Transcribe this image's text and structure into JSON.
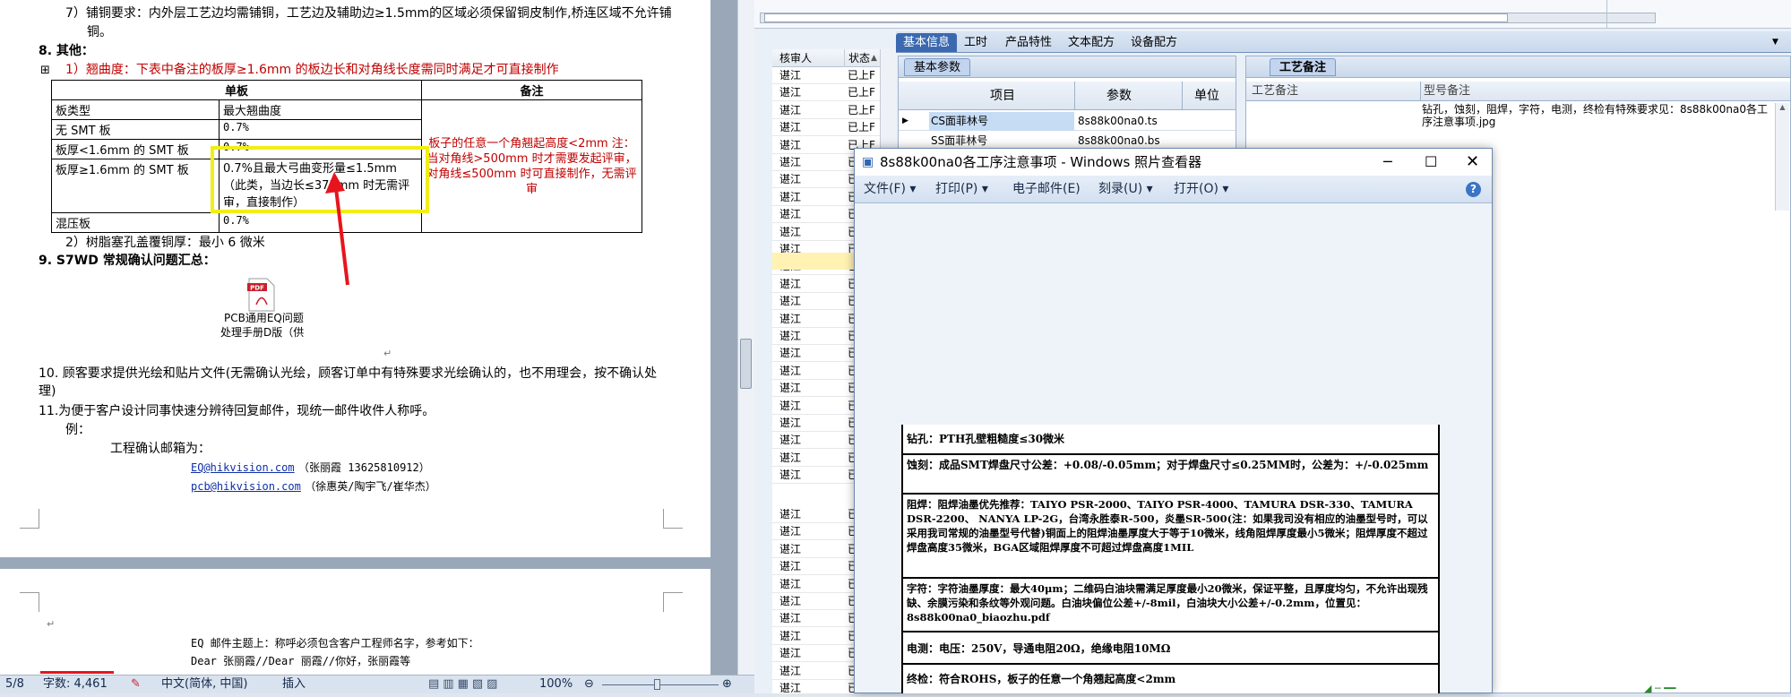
{
  "word_doc": {
    "line_7": "7）铺铜要求：内外层工艺边均需铺铜，工艺边及辅助边≥1.5mm的区域必须保留铜皮制作,桥连区域不允许铺",
    "line_7_cont": "铜。",
    "sec8_title": "8.   其他：",
    "sec8_1": "1）翘曲度：下表中备注的板厚≥1.6mm 的板边长和对角线长度需同时满足才可直接制作",
    "table": {
      "header_left": "单板",
      "header_right": "备注",
      "col1": "板类型",
      "col2": "最大翘曲度",
      "rows": [
        {
          "type": "无 SMT 板",
          "value": "0.7%"
        },
        {
          "type": "板厚<1.6mm 的 SMT 板",
          "value": "0.7%"
        },
        {
          "type": "板厚≥1.6mm 的 SMT 板",
          "value": "0.7%且最大弓曲变形量≤1.5mm（此类，当边长≤375mm 时无需评审，直接制作）"
        },
        {
          "type": "混压板",
          "value": "0.7%"
        }
      ],
      "note": "板子的任意一个角翘起高度<2mm 注：当对角线>500mm 时才需要发起评审，对角线≤500mm 时可直接制作，无需评审"
    },
    "sec8_2": "2）树脂塞孔盖覆铜厚：最小 6 微米",
    "sec9": "9.   S7WD 常规确认问题汇总：",
    "pdf_caption_1": "PCB通用EQ问题",
    "pdf_caption_2": "处理手册D版（供",
    "sec10": "10.  顾客要求提供光绘和贴片文件(无需确认光绘，顾客订单中有特殊要求光绘确认的，也不用理会，按不确认处",
    "sec10_cont": "理)",
    "sec11": "11.为便于客户设计同事快速分辨待回复邮件，现统一邮件收件人称呼。",
    "example": "例：",
    "mail_label": "工程确认邮箱为：",
    "mail_1": "EQ@hikvision.com",
    "mail_1_note": "（张丽霞 13625810912）",
    "mail_2": "pcb@hikvision.com",
    "mail_2_note": "（徐惠英/陶宇飞/崔华杰）",
    "page2_1": "EQ 邮件主题上：称呼必须包含客户工程师名字，参考如下：",
    "page2_2": "Dear  张丽霞//Dear  丽霞//你好，张丽霞等"
  },
  "status_bar": {
    "page": "5/8",
    "word_count": "字数: 4,461",
    "language": "中文(简体, 中国)",
    "mode": "插入",
    "zoom": "100%"
  },
  "app": {
    "grid_headers": {
      "reviewer": "核审人",
      "status": "状态"
    },
    "grid_rows": [
      {
        "reviewer": "谌江",
        "status": "已上F"
      },
      {
        "reviewer": "谌江",
        "status": "已上F"
      },
      {
        "reviewer": "谌江",
        "status": "已上F"
      },
      {
        "reviewer": "谌江",
        "status": "已上F"
      },
      {
        "reviewer": "谌江",
        "status": "已上F"
      },
      {
        "reviewer": "谌江",
        "status": "已上F"
      },
      {
        "reviewer": "谌江",
        "status": "已上F"
      },
      {
        "reviewer": "谌江",
        "status": "已上F"
      },
      {
        "reviewer": "谌江",
        "status": "已"
      },
      {
        "reviewer": "谌江",
        "status": "已"
      },
      {
        "reviewer": "谌江",
        "status": "已"
      },
      {
        "reviewer": "谌江",
        "status": "已"
      },
      {
        "reviewer": "谌江",
        "status": "已"
      },
      {
        "reviewer": "谌江",
        "status": "已"
      },
      {
        "reviewer": "谌江",
        "status": "已"
      },
      {
        "reviewer": "谌江",
        "status": "已"
      },
      {
        "reviewer": "谌江",
        "status": "已"
      },
      {
        "reviewer": "谌江",
        "status": "已"
      },
      {
        "reviewer": "谌江",
        "status": "已"
      },
      {
        "reviewer": "谌江",
        "status": "已"
      },
      {
        "reviewer": "谌江",
        "status": "已"
      },
      {
        "reviewer": "谌江",
        "status": "已"
      },
      {
        "reviewer": "谌江",
        "status": "已"
      },
      {
        "reviewer": "谌江",
        "status": "已"
      }
    ],
    "grid_rows_lower": [
      {
        "reviewer": "谌江",
        "status": "已"
      },
      {
        "reviewer": "谌江",
        "status": "已"
      },
      {
        "reviewer": "谌江",
        "status": "已"
      },
      {
        "reviewer": "谌江",
        "status": "已"
      },
      {
        "reviewer": "谌江",
        "status": "已"
      },
      {
        "reviewer": "谌江",
        "status": "已"
      },
      {
        "reviewer": "谌江",
        "status": "已"
      },
      {
        "reviewer": "谌江",
        "status": "已"
      },
      {
        "reviewer": "谌江",
        "status": "已"
      },
      {
        "reviewer": "谌江",
        "status": "已"
      },
      {
        "reviewer": "谌江",
        "status": "已"
      }
    ],
    "tabs": [
      "基本信息",
      "工时",
      "产品特性",
      "文本配方",
      "设备配方"
    ],
    "param_tab": "基本参数",
    "param_headers": {
      "item": "项目",
      "value": "参数",
      "unit": "单位"
    },
    "param_rows": [
      {
        "item": "CS面菲林号",
        "value": "8s88k00na0.ts"
      },
      {
        "item": "SS面菲林号",
        "value": "8s88k00na0.bs"
      }
    ],
    "note_tab": "工艺备注",
    "note_headers": {
      "left": "工艺备注",
      "right": "型号备注"
    },
    "model_note": "钻孔，蚀刻，阻焊，字符，电测，终检有特殊要求见：8s88k00na0各工序注意事项.jpg"
  },
  "viewer": {
    "title": "8s88k00na0各工序注意事项 - Windows 照片查看器",
    "menu": [
      "文件(F)",
      "打印(P)",
      "电子邮件(E)",
      "刻录(U)",
      "打开(O)"
    ],
    "doc_rows": [
      "钻孔：PTH孔壁粗糙度≤30微米",
      "蚀刻：成品SMT焊盘尺寸公差：+0.08/-0.05mm；对于焊盘尺寸≤0.25MM时，公差为：+/-0.025mm",
      "阻焊：阻焊油墨优先推荐：TAIYO PSR-2000、TAIYO PSR-4000、TAMURA  DSR-330、TAMURA DSR-2200、 NANYA LP-2G，台湾永胜泰R-500，炎墨SR-500(注：如果我司没有相应的油墨型号时，可以采用我司常规的油墨型号代替)铜面上的阻焊油墨厚度大于等于10微米，线角阻焊厚度最小5微米；阻焊厚度不超过焊盘高度35微米，BGA区域阻焊厚度不可超过焊盘高度1MIL",
      "字符：字符油墨厚度：最大40μm；二维码白油块需满足厚度最小20微米，保证平整，且厚度均匀，不允许出现残缺、余膜污染和条纹等外观问题。白油块偏位公差+/-8mil，白油块大小公差+/-0.2mm，位置见：8s88k00na0_biaozhu.pdf",
      "电测：电压：250V，导通电阻20Ω，绝缘电阻10MΩ",
      "终检：符合ROHS，板子的任意一个角翘起高度<2mm"
    ]
  }
}
